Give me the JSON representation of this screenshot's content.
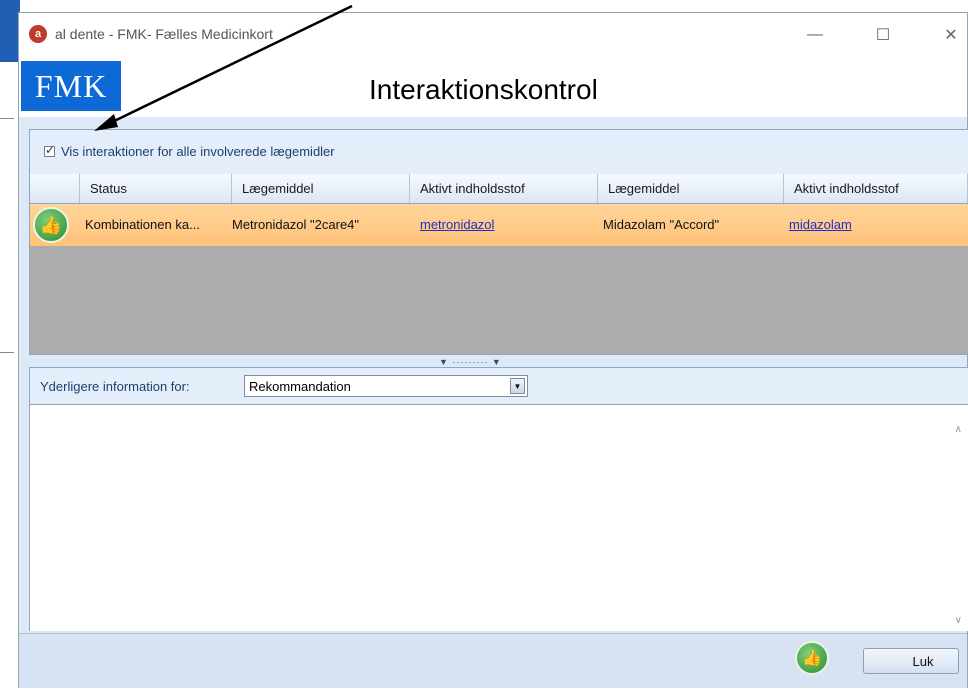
{
  "window": {
    "title": "al dente - FMK- Fælles Medicinkort",
    "minimize": "—",
    "maximize": "☐",
    "close": "✕"
  },
  "header": {
    "logo_text": "FMK",
    "title": "Interaktionskontrol"
  },
  "options": {
    "show_all_interactions_label": "Vis interaktioner for alle involverede lægemidler",
    "show_all_interactions_checked": true
  },
  "grid": {
    "columns": [
      "Status",
      "Lægemiddel",
      "Aktivt indholdsstof",
      "Lægemiddel",
      "Aktivt indholdsstof"
    ],
    "rows": [
      {
        "icon": "thumbs-up-icon",
        "status": "Kombinationen ka...",
        "drug1": "Metronidazol \"2care4\"",
        "substance1": "metronidazol",
        "drug2": "Midazolam \"Accord\"",
        "substance2": "midazolam"
      }
    ],
    "highlight_color": "#ffc27a"
  },
  "details": {
    "label": "Yderligere information for:",
    "selected": "Rekommandation",
    "text": ""
  },
  "footer": {
    "close_label": "Luk",
    "status_icon": "thumbs-up-icon"
  },
  "colors": {
    "fmk_blue": "#0c69d6",
    "panel_bg": "#dde9f7",
    "link": "#1a2fcc"
  }
}
